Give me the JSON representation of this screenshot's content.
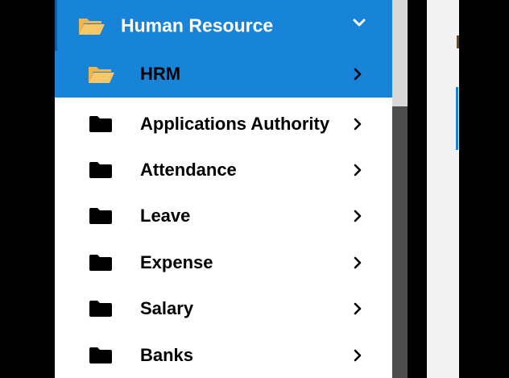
{
  "sidebar": {
    "header": {
      "label": "Human Resource",
      "icon": "folder-open-icon",
      "chevron": "chevron-down-icon"
    },
    "active_item": {
      "label": "HRM",
      "icon": "folder-open-icon",
      "chevron": "chevron-right-icon"
    },
    "items": [
      {
        "label": "Applications Authority",
        "icon": "folder-icon",
        "chevron": "chevron-right-icon"
      },
      {
        "label": "Attendance",
        "icon": "folder-icon",
        "chevron": "chevron-right-icon"
      },
      {
        "label": "Leave",
        "icon": "folder-icon",
        "chevron": "chevron-right-icon"
      },
      {
        "label": "Expense",
        "icon": "folder-icon",
        "chevron": "chevron-right-icon"
      },
      {
        "label": "Salary",
        "icon": "folder-icon",
        "chevron": "chevron-right-icon"
      },
      {
        "label": "Banks",
        "icon": "folder-icon",
        "chevron": "chevron-right-icon"
      }
    ]
  },
  "colors": {
    "accent": "#1784d8",
    "folder_open": "#f5b54a",
    "sidebar_bg": "#ffffff",
    "scrollbar_track": "#4d4d4d",
    "scrollbar_thumb": "#d9d9d9"
  }
}
